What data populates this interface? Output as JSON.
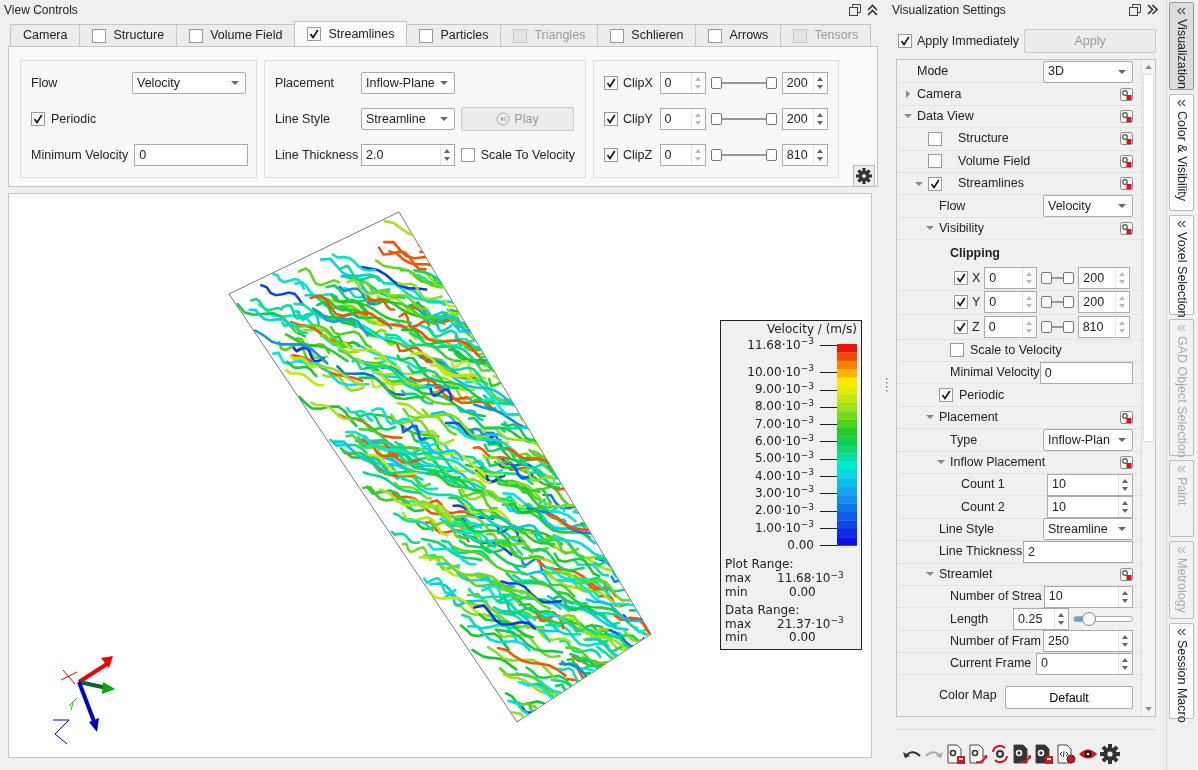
{
  "view_controls": {
    "title": "View Controls",
    "tabs": [
      {
        "label": "Camera",
        "kind": "plain",
        "selected": false,
        "disabled": false
      },
      {
        "label": "Structure",
        "kind": "checkbox",
        "checked": false,
        "selected": false,
        "disabled": false
      },
      {
        "label": "Volume Field",
        "kind": "checkbox",
        "checked": false,
        "selected": false,
        "disabled": false
      },
      {
        "label": "Streamlines",
        "kind": "checkbox",
        "checked": true,
        "selected": true,
        "disabled": false
      },
      {
        "label": "Particles",
        "kind": "checkbox",
        "checked": false,
        "selected": false,
        "disabled": false
      },
      {
        "label": "Triangles",
        "kind": "checkbox",
        "checked": false,
        "selected": false,
        "disabled": true
      },
      {
        "label": "Schlieren",
        "kind": "checkbox",
        "checked": false,
        "selected": false,
        "disabled": false
      },
      {
        "label": "Arrows",
        "kind": "checkbox",
        "checked": false,
        "selected": false,
        "disabled": false
      },
      {
        "label": "Tensors",
        "kind": "checkbox",
        "checked": false,
        "selected": false,
        "disabled": true
      }
    ],
    "flow": {
      "label": "Flow",
      "value": "Velocity"
    },
    "periodic": {
      "label": "Periodic",
      "checked": true
    },
    "minimum_velocity": {
      "label": "Minimum Velocity",
      "value": "0"
    },
    "placement": {
      "label": "Placement",
      "value": "Inflow-Plane"
    },
    "line_style": {
      "label": "Line Style",
      "value": "Streamline"
    },
    "play_button": {
      "label": "Play",
      "disabled": true
    },
    "line_thickness": {
      "label": "Line Thickness",
      "value": "2.0"
    },
    "scale_to_velocity": {
      "label": "Scale To Velocity",
      "checked": false
    },
    "clips": [
      {
        "label": "ClipX",
        "checked": true,
        "min": "0",
        "low": {
          "level": 0
        },
        "high": {
          "level": 1
        },
        "max": "200"
      },
      {
        "label": "ClipY",
        "checked": true,
        "min": "0",
        "low": {
          "level": 0
        },
        "high": {
          "level": 1
        },
        "max": "200"
      },
      {
        "label": "ClipZ",
        "checked": true,
        "min": "0",
        "low": {
          "level": 0
        },
        "high": {
          "level": 1
        },
        "max": "810"
      }
    ]
  },
  "legend": {
    "title": "Velocity / (m/s)",
    "ticks": [
      "11.68·10$^{−3}$",
      "10.00·10$^{−3}$",
      "9.00·10$^{−3}$",
      "8.00·10$^{−3}$",
      "7.00·10$^{−3}$",
      "6.00·10$^{−3}$",
      "5.00·10$^{−3}$",
      "4.00·10$^{−3}$",
      "3.00·10$^{−3}$",
      "2.00·10$^{−3}$",
      "1.00·10$^{−3}$",
      "0.00"
    ],
    "ranges": [
      {
        "title": "Plot Range:",
        "max_label": "max",
        "max": "11.68·10$^{−3}$",
        "min_label": "min",
        "min": "0.00"
      },
      {
        "title": "Data Range:",
        "max_label": "max",
        "max": "21.37·10$^{−3}$",
        "min_label": "min",
        "min": "0.00"
      }
    ]
  },
  "settings": {
    "title": "Visualization Settings",
    "apply_immediately": {
      "label": "Apply Immediately",
      "checked": true
    },
    "apply_button": {
      "label": "Apply",
      "disabled": true
    },
    "tree": [
      {
        "kind": "select",
        "label": "Mode",
        "value": "3D"
      },
      {
        "kind": "group",
        "label": "Camera",
        "expanded": false
      },
      {
        "kind": "group",
        "label": "Data View",
        "expanded": true,
        "children": [
          {
            "kind": "layer",
            "label": "Structure",
            "checked": false
          },
          {
            "kind": "layer",
            "label": "Volume Field",
            "checked": false
          },
          {
            "kind": "checkgroup",
            "label": "Streamlines",
            "checked": true,
            "expanded": true,
            "children": [
              {
                "kind": "select",
                "label": "Flow",
                "value": "Velocity"
              },
              {
                "kind": "group",
                "label": "Visibility",
                "expanded": true,
                "children": [
                  {
                    "kind": "heading",
                    "label": "Clipping"
                  },
                  {
                    "kind": "clip",
                    "label": "X",
                    "checked": true,
                    "min": "0",
                    "low": {
                      "level": 0
                    },
                    "high": {
                      "level": 1
                    },
                    "max": "200"
                  },
                  {
                    "kind": "clip",
                    "label": "Y",
                    "checked": true,
                    "min": "0",
                    "low": {
                      "level": 0
                    },
                    "high": {
                      "level": 1
                    },
                    "max": "200"
                  },
                  {
                    "kind": "clip",
                    "label": "Z",
                    "checked": true,
                    "min": "0",
                    "low": {
                      "level": 0
                    },
                    "high": {
                      "level": 1
                    },
                    "max": "810"
                  },
                  {
                    "kind": "check",
                    "label": "Scale to Velocity",
                    "checked": false
                  },
                  {
                    "kind": "text",
                    "label": "Minimal Velocity",
                    "value": "0"
                  }
                ]
              },
              {
                "kind": "check",
                "label": "Periodic",
                "checked": true
              },
              {
                "kind": "group",
                "label": "Placement",
                "expanded": true,
                "children": [
                  {
                    "kind": "select",
                    "label": "Type",
                    "value": "Inflow-Plan"
                  },
                  {
                    "kind": "group",
                    "label": "Inflow Placement",
                    "expanded": true,
                    "children": [
                      {
                        "kind": "spin",
                        "label": "Count 1",
                        "value": "10"
                      },
                      {
                        "kind": "spin",
                        "label": "Count 2",
                        "value": "10"
                      }
                    ]
                  }
                ]
              },
              {
                "kind": "select",
                "label": "Line Style",
                "value": "Streamline"
              },
              {
                "kind": "text",
                "label": "Line Thickness",
                "value": "2"
              },
              {
                "kind": "group",
                "label": "Streamlet",
                "expanded": true,
                "children": [
                  {
                    "kind": "spin",
                    "label": "Number of Strea",
                    "value": "10"
                  },
                  {
                    "kind": "slider",
                    "label": "Length",
                    "value": "0.25",
                    "level": 0.25
                  },
                  {
                    "kind": "spin",
                    "label": "Number of Fram",
                    "value": "250"
                  },
                  {
                    "kind": "spin",
                    "label": "Current Frame",
                    "value": "0"
                  }
                ]
              },
              {
                "kind": "button",
                "label": "Color Map",
                "value": "Default"
              }
            ]
          }
        ]
      }
    ]
  },
  "side_tabs": [
    {
      "label": "Visualization",
      "selected": true,
      "disabled": false
    },
    {
      "label": "Color & Visibility",
      "selected": false,
      "disabled": false
    },
    {
      "label": "Voxel Selection",
      "selected": false,
      "disabled": false
    },
    {
      "label": "GAD Object Selection",
      "selected": false,
      "disabled": true
    },
    {
      "label": "Paint",
      "selected": false,
      "disabled": true
    },
    {
      "label": "Metrology",
      "selected": false,
      "disabled": true
    },
    {
      "label": "Session Macro",
      "selected": false,
      "disabled": false
    }
  ]
}
